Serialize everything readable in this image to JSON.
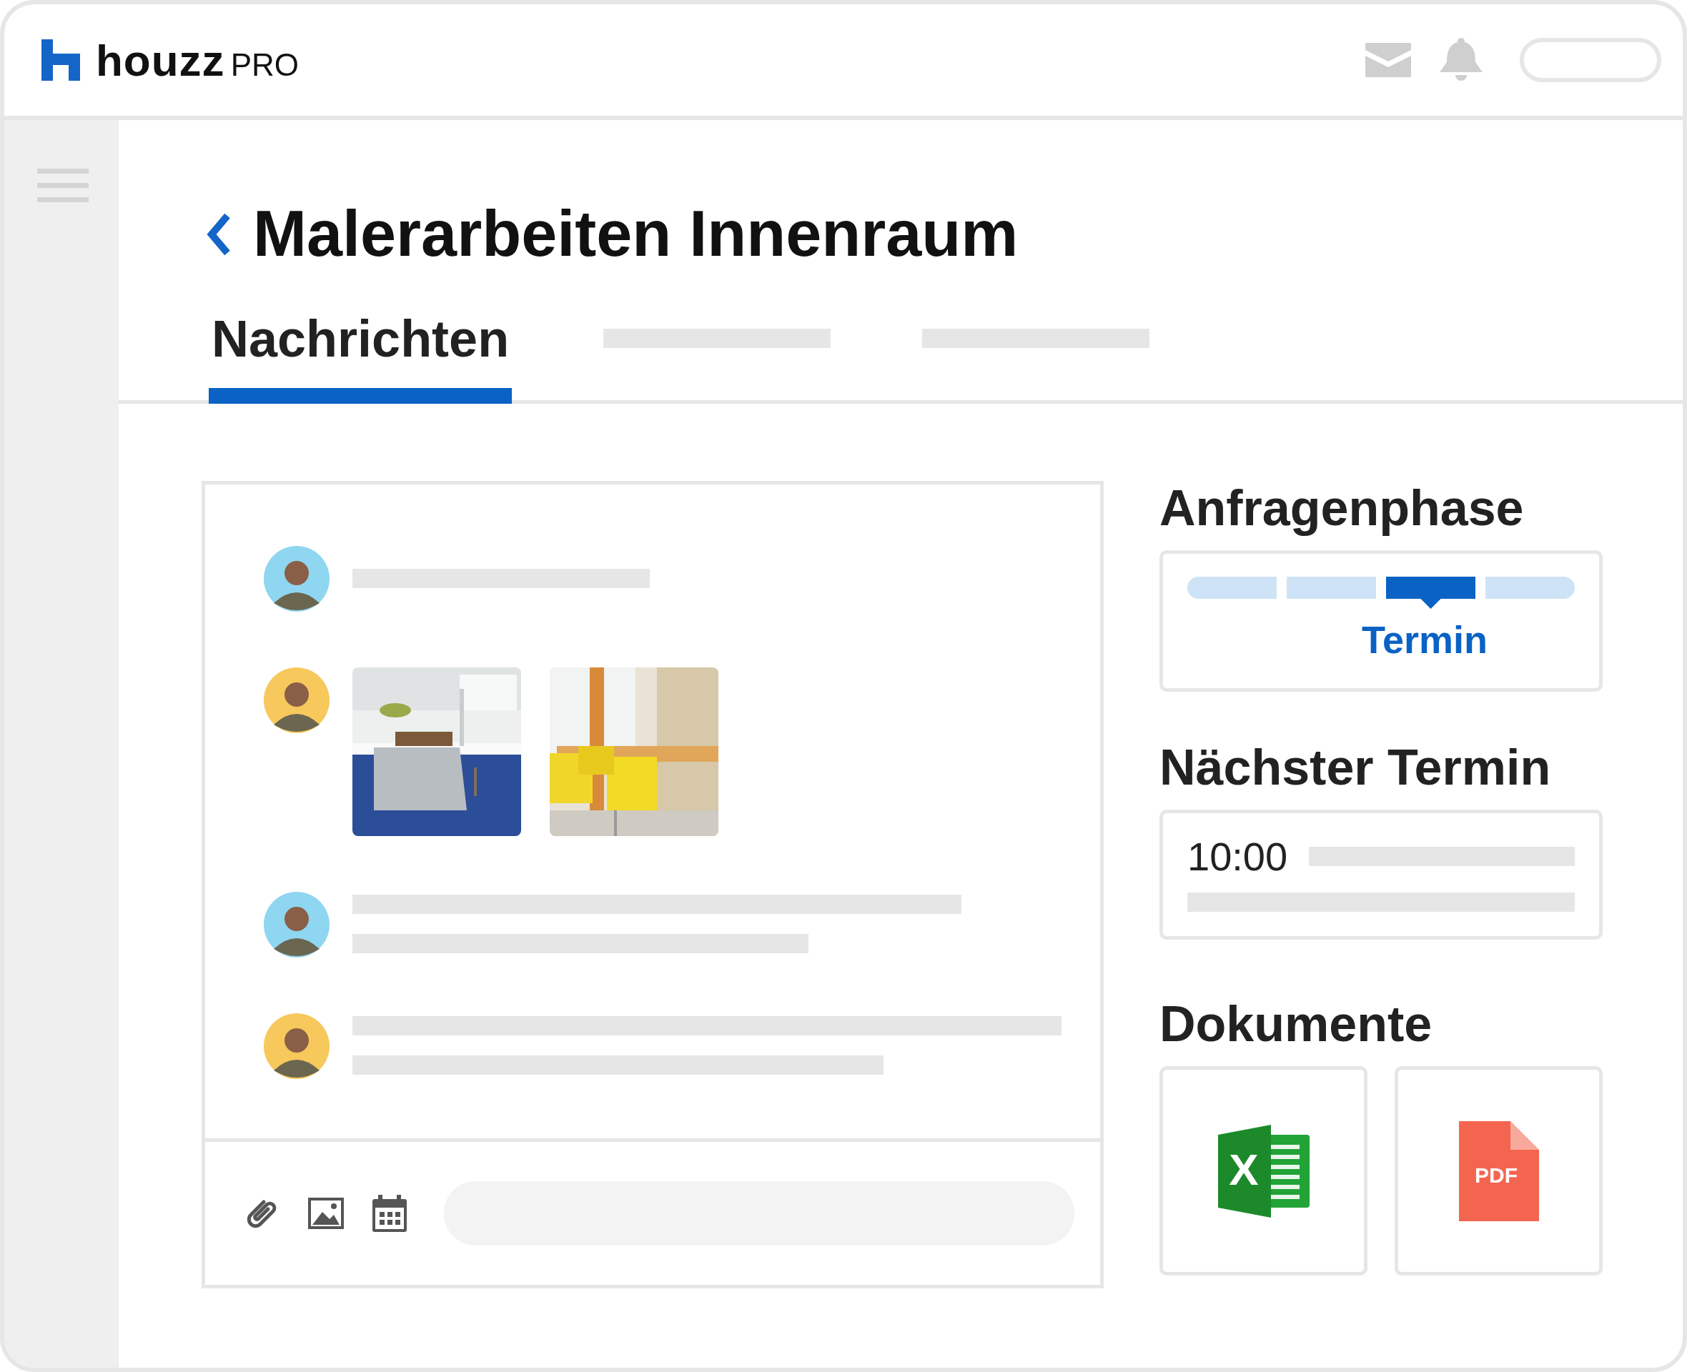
{
  "header": {
    "logo": {
      "name": "houzz",
      "suffix": "PRO"
    }
  },
  "page": {
    "title": "Malerarbeiten Innenraum"
  },
  "tabs": [
    {
      "kind": "label",
      "label": "Nachrichten",
      "selected": true
    },
    {
      "kind": "placeholder",
      "selected": false
    },
    {
      "kind": "placeholder",
      "selected": false
    }
  ],
  "messages": [
    {
      "kind": "line",
      "color": "#8fd6f0"
    },
    {
      "kind": "images",
      "color": "#f7c85c"
    },
    {
      "kind": "lines",
      "color": "#8fd6f0"
    },
    {
      "kind": "lines",
      "color": "#f7c85c"
    }
  ],
  "phase": {
    "title": "Anfragenphase",
    "steps": [
      {
        "selected": false
      },
      {
        "selected": false
      },
      {
        "selected": true
      },
      {
        "selected": false
      }
    ],
    "label": "Termin"
  },
  "next_appointment": {
    "title": "Nächster Termin",
    "time": "10:00"
  },
  "documents": {
    "title": "Dokumente",
    "files": [
      {
        "kind": "excel",
        "label": "X"
      },
      {
        "kind": "pdf",
        "label": "PDF"
      }
    ]
  }
}
